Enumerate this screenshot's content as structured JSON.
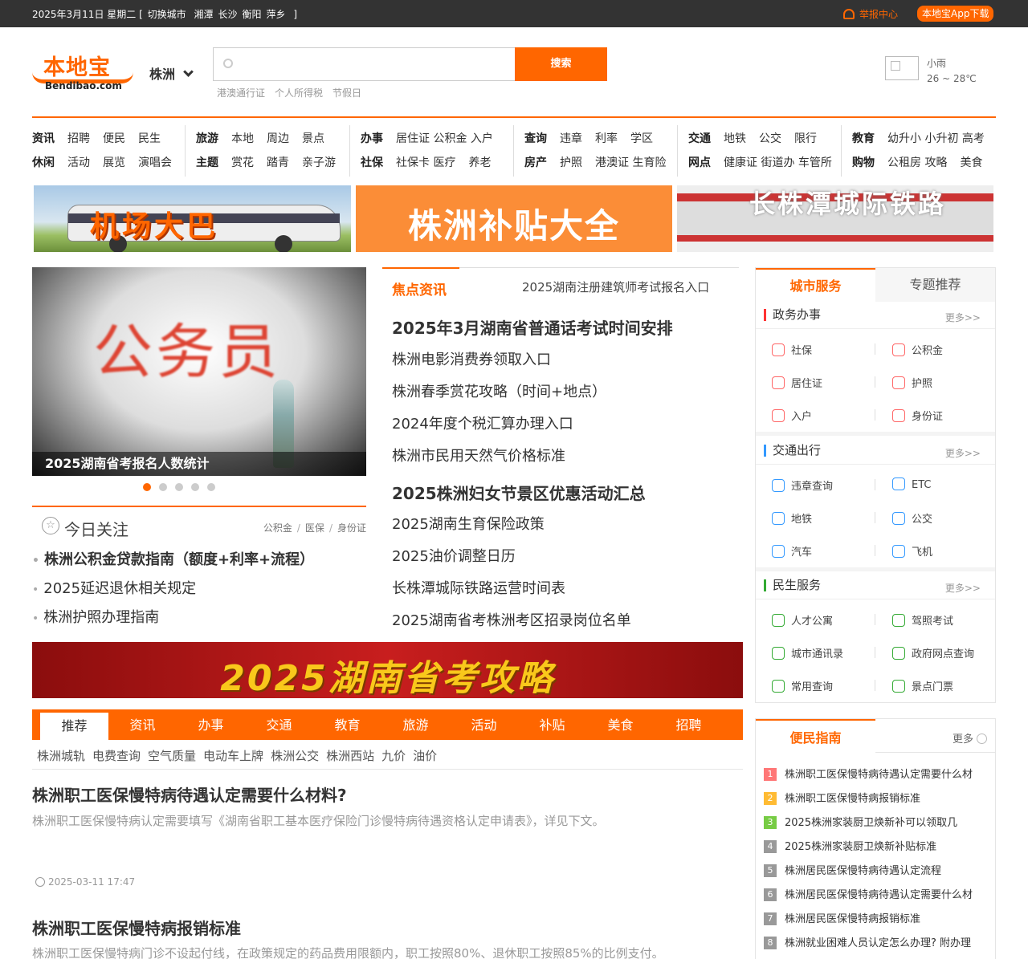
{
  "topbar": {
    "date": "2025年3月11日  星期二",
    "bracket_open": "[",
    "switch_label": "切换城市",
    "cities": [
      "湘潭",
      "长沙",
      "衡阳",
      "萍乡"
    ],
    "bracket_close": "]",
    "report": "举报中心",
    "app_download": "本地宝App下载",
    "accent": "#ff6600"
  },
  "header": {
    "logo_text": "本地宝",
    "logo_domain": "Bendibao.com",
    "city": "株洲",
    "search_placeholder": "",
    "search_button": "搜索",
    "hot_words": [
      "港澳通行证",
      "个人所得税",
      "节假日"
    ],
    "weather_desc": "小雨",
    "weather_temp": "26 ~ 28℃",
    "weather_icon": "weather-image-icon"
  },
  "nav": [
    {
      "r1": [
        {
          "t": "资讯",
          "hd": true
        },
        {
          "t": "招聘"
        },
        {
          "t": "便民"
        },
        {
          "t": "民生"
        }
      ],
      "r2": [
        {
          "t": "休闲",
          "hd": true
        },
        {
          "t": "活动"
        },
        {
          "t": "展览"
        },
        {
          "t": "演唱会"
        }
      ]
    },
    {
      "r1": [
        {
          "t": "旅游",
          "hd": true
        },
        {
          "t": "本地"
        },
        {
          "t": "周边"
        },
        {
          "t": "景点"
        }
      ],
      "r2": [
        {
          "t": "主题",
          "hd": true
        },
        {
          "t": "赏花"
        },
        {
          "t": "踏青"
        },
        {
          "t": "亲子游"
        }
      ]
    },
    {
      "r1": [
        {
          "t": "办事",
          "hd": true
        },
        {
          "t": "居住证 公积金 入户"
        }
      ],
      "r2": [
        {
          "t": "社保",
          "hd": true
        },
        {
          "t": "社保卡 医疗"
        },
        {
          "t": "养老"
        }
      ]
    },
    {
      "r1": [
        {
          "t": "查询",
          "hd": true
        },
        {
          "t": "违章"
        },
        {
          "t": "利率"
        },
        {
          "t": "学区"
        }
      ],
      "r2": [
        {
          "t": "房产",
          "hd": true
        },
        {
          "t": "护照"
        },
        {
          "t": "港澳证 生育险"
        }
      ]
    },
    {
      "r1": [
        {
          "t": "交通",
          "hd": true
        },
        {
          "t": "地铁"
        },
        {
          "t": "公交"
        },
        {
          "t": "限行"
        }
      ],
      "r2": [
        {
          "t": "网点",
          "hd": true
        },
        {
          "t": "健康证 街道办 车管所"
        }
      ]
    },
    {
      "r1": [
        {
          "t": "教育",
          "hd": true
        },
        {
          "t": "幼升小 小升初 高考"
        }
      ],
      "r2": [
        {
          "t": "购物",
          "hd": true
        },
        {
          "t": "公租房 攻略"
        },
        {
          "t": "美食"
        }
      ]
    }
  ],
  "banners": [
    "机场大巴",
    "株洲补贴大全",
    "长株潭城际铁路"
  ],
  "slider": {
    "image_text": "公务员",
    "caption": "2025湖南省考报名人数统计",
    "dots": 5,
    "active_dot": 0
  },
  "today": {
    "title": "今日关注",
    "tags": [
      "公积金",
      "医保",
      "身份证"
    ],
    "items": [
      "株洲公积金贷款指南（额度+利率+流程）",
      "2025延迟退休相关规定",
      "株洲护照办理指南"
    ]
  },
  "focus": {
    "tab": "焦点资讯",
    "subtitle": "2025湖南注册建筑师考试报名入口",
    "items": [
      {
        "t": "2025年3月湖南省普通话考试时间安排",
        "big": true
      },
      {
        "t": "株洲电影消费券领取入口"
      },
      {
        "t": "株洲春季赏花攻略（时间+地点）"
      },
      {
        "t": "2024年度个税汇算办理入口"
      },
      {
        "t": "株洲市民用天然气价格标准"
      },
      {
        "t": "2025株洲妇女节景区优惠活动汇总",
        "big": true
      },
      {
        "t": "2025湖南生育保险政策"
      },
      {
        "t": "2025油价调整日历"
      },
      {
        "t": "长株潭城际铁路运营时间表"
      },
      {
        "t": "2025湖南省考株洲考区招录岗位名单"
      }
    ]
  },
  "red_banner": "2025湖南省考攻略",
  "cat_tabs": [
    "推荐",
    "资讯",
    "办事",
    "交通",
    "教育",
    "旅游",
    "活动",
    "补贴",
    "美食",
    "招聘"
  ],
  "sub_cats": [
    "株洲城轨",
    "电费查询",
    "空气质量",
    "电动车上牌",
    "株洲公交",
    "株洲西站",
    "九价",
    "油价"
  ],
  "articles": [
    {
      "title": "株洲职工医保慢特病待遇认定需要什么材料?",
      "summary": "株洲职工医保慢特病认定需要填写《湖南省职工基本医疗保险门诊慢特病待遇资格认定申请表》，详见下文。",
      "time": "2025-03-11 17:47"
    },
    {
      "title": "株洲职工医保慢特病报销标准",
      "summary": "株洲职工医保慢特病门诊不设起付线，在政策规定的药品费用限额内，职工按照80%、退休职工按照85%的比例支付。"
    }
  ],
  "services": {
    "tabs": [
      "城市服务",
      "专题推荐"
    ],
    "more": "更多>>",
    "groups": [
      {
        "title": "政务办事",
        "color": "red",
        "items": [
          "社保",
          "公积金",
          "居住证",
          "护照",
          "入户",
          "身份证"
        ]
      },
      {
        "title": "交通出行",
        "color": "blue",
        "items": [
          "违章查询",
          "ETC",
          "地铁",
          "公交",
          "汽车",
          "飞机"
        ]
      },
      {
        "title": "民生服务",
        "color": "green",
        "items": [
          "人才公寓",
          "驾照考试",
          "城市通讯录",
          "政府网点查询",
          "常用查询",
          "景点门票"
        ]
      }
    ]
  },
  "guide": {
    "title": "便民指南",
    "more": "更多",
    "num_colors": [
      "#f77",
      "#fb3",
      "#7c4",
      "#999",
      "#999",
      "#999",
      "#999",
      "#999"
    ],
    "items": [
      "株洲职工医保慢特病待遇认定需要什么材",
      "株洲职工医保慢特病报销标准",
      "2025株洲家装厨卫焕新补可以领取几",
      "2025株洲家装厨卫焕新补贴标准",
      "株洲居民医保慢特病待遇认定流程",
      "株洲居民医保慢特病待遇认定需要什么材",
      "株洲居民医保慢特病报销标准",
      "株洲就业困难人员认定怎么办理? 附办理"
    ]
  }
}
